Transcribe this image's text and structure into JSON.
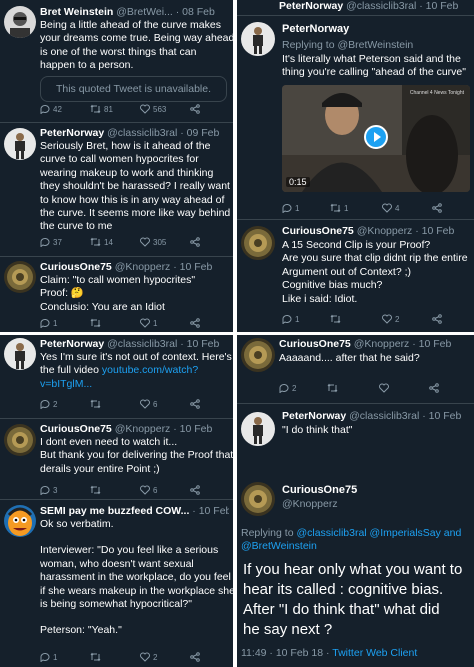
{
  "tl": {
    "t1": {
      "name": "Bret Weinstein",
      "meta": "@BretWei... · 08 Feb",
      "lines": [
        "Being a little ahead of the curve makes",
        "your dreams come true. Being way ahead",
        "is one of the worst things that can",
        "happen to a person."
      ],
      "quoted": "This quoted Tweet is unavailable.",
      "replies": "42",
      "retweets": "81",
      "likes": "563"
    },
    "t2": {
      "name": "PeterNorway",
      "meta": "@classiclib3ral · 09 Feb",
      "lines": [
        "Seriously Bret, how is it ahead of the",
        "curve to call women hypocrites for",
        "wearing makeup to work and thinking",
        "they shouldn't be harassed? I really want",
        "to know how this is in any way ahead of",
        "the curve. It seems more like way behind",
        "the curve to me"
      ],
      "replies": "37",
      "retweets": "14",
      "likes": "305"
    },
    "t3": {
      "name": "CuriousOne75",
      "meta": "@Knopperz · 10 Feb",
      "lines": [
        "Claim: \"to call women hypocrites\"",
        "Proof: 🤔",
        "Conclusio: You are an Idiot"
      ],
      "replies": "1",
      "retweets": "",
      "likes": "1"
    }
  },
  "tr": {
    "t1": {
      "name": "PeterNorway",
      "meta": "@classiclib3ral · 10 Feb",
      "reply_to": "Replying to @BretWeinstein",
      "lines": [
        "It's literally what Peterson said and the",
        "thing you're calling \"ahead of the curve\""
      ],
      "video_time": "0:15",
      "video_brand": "Channel 4 News Tonight",
      "replies": "1",
      "retweets": "1",
      "likes": "4"
    },
    "t2": {
      "name": "CuriousOne75",
      "meta": "@Knopperz · 10 Feb",
      "lines": [
        "A 15 Second Clip is your Proof?",
        "Are you sure that clip didnt rip the entire",
        "Argument out of Context? ;)",
        "Cognitive bias much?",
        "Like i said: Idiot."
      ],
      "replies": "1",
      "retweets": "",
      "likes": "2"
    }
  },
  "bl": {
    "t1": {
      "name": "PeterNorway",
      "meta": "@classiclib3ral · 10 Feb",
      "lines": [
        "Yes I'm sure it's not out of context. Here's",
        "the full video"
      ],
      "link1": "youtube.com/watch?",
      "link2": "v=bITglM...",
      "replies": "2",
      "retweets": "",
      "likes": "6"
    },
    "t2": {
      "name": "CuriousOne75",
      "meta": "@Knopperz · 10 Feb",
      "lines": [
        "I dont even need to watch it...",
        "But thank you for delivering the Proof that",
        "derails your entire Point ;)"
      ],
      "replies": "3",
      "retweets": "",
      "likes": "6"
    },
    "t3": {
      "name": "SEMI pay me buzzfeed COW...",
      "meta": "· 10 Feb",
      "lines": [
        "Ok so verbatim.",
        "",
        "Interviewer: \"Do you feel like a serious",
        "woman, who doesn't want sexual",
        "harassment in the workplace, do you feel",
        "if she wears makeup in the workplace she",
        "is being somewhat hypocritical?\"",
        "",
        "Peterson: \"Yeah.\""
      ],
      "replies": "1",
      "retweets": "",
      "likes": "2"
    }
  },
  "br": {
    "t1": {
      "name": "CuriousOne75",
      "meta": "@Knopperz · 10 Feb",
      "lines": [
        "Aaaaand.... after that he said?"
      ],
      "replies": "2",
      "retweets": "",
      "likes": ""
    },
    "t2": {
      "name": "PeterNorway",
      "meta": "@classiclib3ral · 10 Feb",
      "lines": [
        "\"I do think that\""
      ]
    },
    "t3": {
      "name": "CuriousOne75",
      "handle": "@Knopperz",
      "reply_prefix": "Replying to ",
      "reply_users": "@classiclib3ral @ImperialsSay and",
      "reply_users2": "@BretWeinstein",
      "big_lines": [
        "If you hear only what you want to",
        "hear its called : cognitive bias.",
        "After \"I do think that\" what did",
        "he say next ?"
      ],
      "footer_time": "11:49 · 10 Feb 18 · ",
      "footer_client": "Twitter Web Client"
    }
  },
  "colors": {
    "bg": "#15202b",
    "text": "#ffffff",
    "muted": "#8899a6",
    "link": "#1da1f2",
    "divider": "#38444d"
  }
}
